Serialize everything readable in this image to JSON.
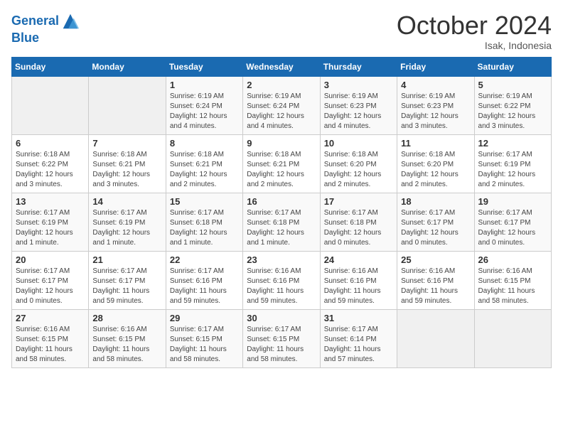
{
  "logo": {
    "line1": "General",
    "line2": "Blue"
  },
  "title": "October 2024",
  "subtitle": "Isak, Indonesia",
  "days_of_week": [
    "Sunday",
    "Monday",
    "Tuesday",
    "Wednesday",
    "Thursday",
    "Friday",
    "Saturday"
  ],
  "weeks": [
    [
      {
        "day": "",
        "info": ""
      },
      {
        "day": "",
        "info": ""
      },
      {
        "day": "1",
        "info": "Sunrise: 6:19 AM\nSunset: 6:24 PM\nDaylight: 12 hours and 4 minutes."
      },
      {
        "day": "2",
        "info": "Sunrise: 6:19 AM\nSunset: 6:24 PM\nDaylight: 12 hours and 4 minutes."
      },
      {
        "day": "3",
        "info": "Sunrise: 6:19 AM\nSunset: 6:23 PM\nDaylight: 12 hours and 4 minutes."
      },
      {
        "day": "4",
        "info": "Sunrise: 6:19 AM\nSunset: 6:23 PM\nDaylight: 12 hours and 3 minutes."
      },
      {
        "day": "5",
        "info": "Sunrise: 6:19 AM\nSunset: 6:22 PM\nDaylight: 12 hours and 3 minutes."
      }
    ],
    [
      {
        "day": "6",
        "info": "Sunrise: 6:18 AM\nSunset: 6:22 PM\nDaylight: 12 hours and 3 minutes."
      },
      {
        "day": "7",
        "info": "Sunrise: 6:18 AM\nSunset: 6:21 PM\nDaylight: 12 hours and 3 minutes."
      },
      {
        "day": "8",
        "info": "Sunrise: 6:18 AM\nSunset: 6:21 PM\nDaylight: 12 hours and 2 minutes."
      },
      {
        "day": "9",
        "info": "Sunrise: 6:18 AM\nSunset: 6:21 PM\nDaylight: 12 hours and 2 minutes."
      },
      {
        "day": "10",
        "info": "Sunrise: 6:18 AM\nSunset: 6:20 PM\nDaylight: 12 hours and 2 minutes."
      },
      {
        "day": "11",
        "info": "Sunrise: 6:18 AM\nSunset: 6:20 PM\nDaylight: 12 hours and 2 minutes."
      },
      {
        "day": "12",
        "info": "Sunrise: 6:17 AM\nSunset: 6:19 PM\nDaylight: 12 hours and 2 minutes."
      }
    ],
    [
      {
        "day": "13",
        "info": "Sunrise: 6:17 AM\nSunset: 6:19 PM\nDaylight: 12 hours and 1 minute."
      },
      {
        "day": "14",
        "info": "Sunrise: 6:17 AM\nSunset: 6:19 PM\nDaylight: 12 hours and 1 minute."
      },
      {
        "day": "15",
        "info": "Sunrise: 6:17 AM\nSunset: 6:18 PM\nDaylight: 12 hours and 1 minute."
      },
      {
        "day": "16",
        "info": "Sunrise: 6:17 AM\nSunset: 6:18 PM\nDaylight: 12 hours and 1 minute."
      },
      {
        "day": "17",
        "info": "Sunrise: 6:17 AM\nSunset: 6:18 PM\nDaylight: 12 hours and 0 minutes."
      },
      {
        "day": "18",
        "info": "Sunrise: 6:17 AM\nSunset: 6:17 PM\nDaylight: 12 hours and 0 minutes."
      },
      {
        "day": "19",
        "info": "Sunrise: 6:17 AM\nSunset: 6:17 PM\nDaylight: 12 hours and 0 minutes."
      }
    ],
    [
      {
        "day": "20",
        "info": "Sunrise: 6:17 AM\nSunset: 6:17 PM\nDaylight: 12 hours and 0 minutes."
      },
      {
        "day": "21",
        "info": "Sunrise: 6:17 AM\nSunset: 6:17 PM\nDaylight: 11 hours and 59 minutes."
      },
      {
        "day": "22",
        "info": "Sunrise: 6:17 AM\nSunset: 6:16 PM\nDaylight: 11 hours and 59 minutes."
      },
      {
        "day": "23",
        "info": "Sunrise: 6:16 AM\nSunset: 6:16 PM\nDaylight: 11 hours and 59 minutes."
      },
      {
        "day": "24",
        "info": "Sunrise: 6:16 AM\nSunset: 6:16 PM\nDaylight: 11 hours and 59 minutes."
      },
      {
        "day": "25",
        "info": "Sunrise: 6:16 AM\nSunset: 6:16 PM\nDaylight: 11 hours and 59 minutes."
      },
      {
        "day": "26",
        "info": "Sunrise: 6:16 AM\nSunset: 6:15 PM\nDaylight: 11 hours and 58 minutes."
      }
    ],
    [
      {
        "day": "27",
        "info": "Sunrise: 6:16 AM\nSunset: 6:15 PM\nDaylight: 11 hours and 58 minutes."
      },
      {
        "day": "28",
        "info": "Sunrise: 6:16 AM\nSunset: 6:15 PM\nDaylight: 11 hours and 58 minutes."
      },
      {
        "day": "29",
        "info": "Sunrise: 6:17 AM\nSunset: 6:15 PM\nDaylight: 11 hours and 58 minutes."
      },
      {
        "day": "30",
        "info": "Sunrise: 6:17 AM\nSunset: 6:15 PM\nDaylight: 11 hours and 58 minutes."
      },
      {
        "day": "31",
        "info": "Sunrise: 6:17 AM\nSunset: 6:14 PM\nDaylight: 11 hours and 57 minutes."
      },
      {
        "day": "",
        "info": ""
      },
      {
        "day": "",
        "info": ""
      }
    ]
  ]
}
